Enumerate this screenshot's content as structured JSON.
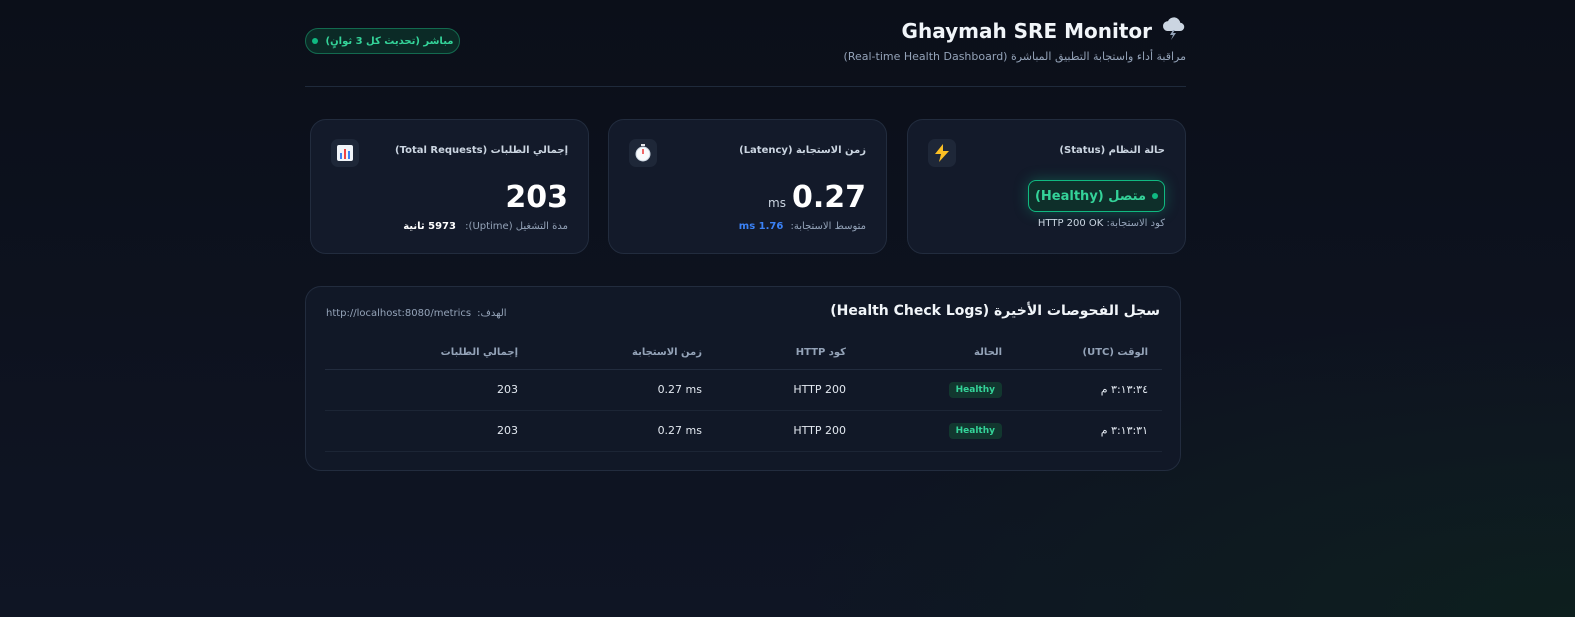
{
  "header": {
    "title": "Ghaymah SRE Monitor",
    "title_icon": "cloud-lightning-icon",
    "subtitle": "مراقبة أداء واستجابة التطبيق المباشرة (Real-time Health Dashboard)",
    "live_badge": "مباشر (تحديث كل 3 ثوانٍ)"
  },
  "cards": {
    "status": {
      "label": "حالة النظام (Status)",
      "icon": "lightning-icon",
      "value": "متصل (Healthy)",
      "foot_label": "كود الاستجابة:",
      "foot_value": "HTTP 200 OK"
    },
    "latency": {
      "label": "زمن الاستجابة (Latency)",
      "icon": "stopwatch-icon",
      "value": "0.27",
      "unit": "ms",
      "avg_label": "متوسط الاستجابة:",
      "avg_value": "1.76 ms"
    },
    "requests": {
      "label": "إجمالي الطلبات (Total Requests)",
      "icon": "bar-chart-icon",
      "value": "203",
      "uptime_label": "مدة التشغيل (Uptime):",
      "uptime_value": "5973 ثانية"
    }
  },
  "logs": {
    "title": "سجل الفحوصات الأخيرة (Health Check Logs)",
    "target_label": "الهدف:",
    "target_url": "http://localhost:8080/metrics",
    "columns": [
      "الوقت (UTC)",
      "الحالة",
      "كود HTTP",
      "زمن الاستجابة",
      "إجمالي الطلبات"
    ],
    "rows": [
      {
        "time": "٣:١٣:٣٤ م",
        "state": "Healthy",
        "code": "HTTP 200",
        "latency": "0.27 ms",
        "total": "203"
      },
      {
        "time": "٣:١٣:٣١ م",
        "state": "Healthy",
        "code": "HTTP 200",
        "latency": "0.27 ms",
        "total": "203"
      }
    ]
  },
  "colors": {
    "background": "#0b0f19",
    "card": "#131a2a",
    "accent_green": "#10b981",
    "accent_blue": "#3b82f6"
  }
}
